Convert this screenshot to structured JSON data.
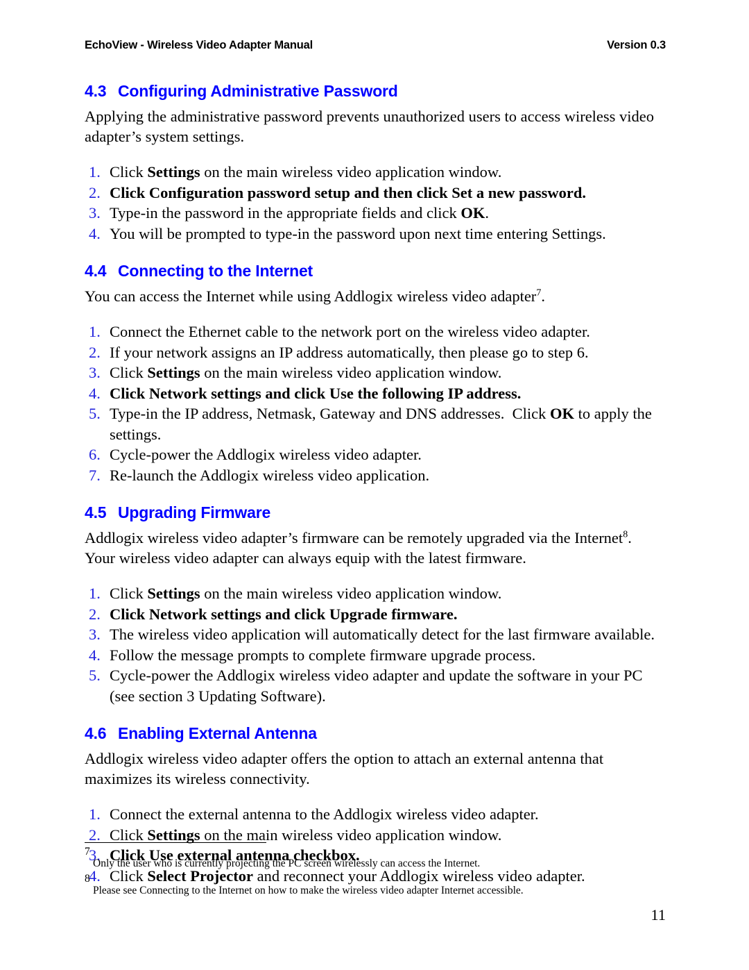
{
  "header": {
    "left": "EchoView - Wireless Video Adapter Manual",
    "right": "Version 0.3"
  },
  "sections": [
    {
      "number": "4.3",
      "title": "Configuring Administrative Password",
      "paragraph": "Applying the administrative password prevents unauthorized users to access wireless video adapter’s system settings.",
      "steps": [
        {
          "num": "1.",
          "html": "Click <b>Settings</b> on the main wireless video application window."
        },
        {
          "num": "2.",
          "html": "<b>Click <b>Configuration password setup</b> and then click <b>Set a new password</b>.</b>"
        },
        {
          "num": "3.",
          "html": "Type-in the password in the appropriate fields and click <b>OK</b>."
        },
        {
          "num": "4.",
          "html": "You will be prompted to type-in the password upon next time entering Settings."
        }
      ]
    },
    {
      "number": "4.4",
      "title": "Connecting to the Internet",
      "paragraph_html": "You can access the Internet while using Addlogix wireless video adapter<sup class=\"fn\">7</sup>.",
      "steps": [
        {
          "num": "1.",
          "html": "Connect the Ethernet cable to the network port on the wireless video adapter."
        },
        {
          "num": "2.",
          "html": "If your network assigns an IP address automatically, then please go to step 6."
        },
        {
          "num": "3.",
          "html": "Click <b>Settings</b> on the main wireless video application window."
        },
        {
          "num": "4.",
          "html": "<b>Click <b>Network settings</b> and click <b>Use the following IP address</b>.</b>"
        },
        {
          "num": "5.",
          "html": "Type-in the IP address, Netmask, Gateway and DNS addresses.&nbsp; Click <b>OK</b> to apply the settings."
        },
        {
          "num": "6.",
          "html": "Cycle-power the Addlogix wireless video adapter."
        },
        {
          "num": "7.",
          "html": "Re-launch the Addlogix wireless video application."
        }
      ]
    },
    {
      "number": "4.5",
      "title": "Upgrading Firmware",
      "paragraph_html": "Addlogix wireless video adapter’s firmware can be remotely upgraded via the Internet<sup class=\"fn\">8</sup>.&nbsp; Your wireless video adapter can always equip with the latest firmware.",
      "steps": [
        {
          "num": "1.",
          "html": "Click <b>Settings</b> on the main wireless video application window."
        },
        {
          "num": "2.",
          "html": "<b>Click <b>Network settings</b> and click <b>Upgrade firmware</b>.</b>"
        },
        {
          "num": "3.",
          "html": "The wireless video application will automatically detect for the last firmware available."
        },
        {
          "num": "4.",
          "html": "Follow the message prompts to complete firmware upgrade process."
        },
        {
          "num": "5.",
          "html": "Cycle-power the Addlogix wireless video adapter and update the software in your PC (see section 3 Updating Software)."
        }
      ]
    },
    {
      "number": "4.6",
      "title": "Enabling External Antenna",
      "paragraph": "Addlogix wireless video adapter offers the option to attach an external antenna that maximizes its wireless connectivity.",
      "steps": [
        {
          "num": "1.",
          "html": "Connect the external antenna to the Addlogix wireless video adapter."
        },
        {
          "num": "2.",
          "html": "Click <b>Settings</b> on the main wireless video application window."
        },
        {
          "num": "3.",
          "html": "<b>Click <b>Use external antenna</b> checkbox.</b>"
        },
        {
          "num": "4.",
          "html": "Click <b>Select Projector</b> and reconnect your Addlogix wireless video adapter."
        }
      ]
    }
  ],
  "footnotes": [
    {
      "marker": "7",
      "text": "Only the user who is currently projecting the PC screen wirelessly can access the Internet."
    },
    {
      "marker": "8",
      "text": "Please see Connecting to the Internet on how to make the wireless video adapter Internet accessible."
    }
  ],
  "page_number": "11",
  "colors": {
    "heading_blue": "#0000FF",
    "list_number_blue": "#2222DD",
    "text_black": "#000000"
  }
}
